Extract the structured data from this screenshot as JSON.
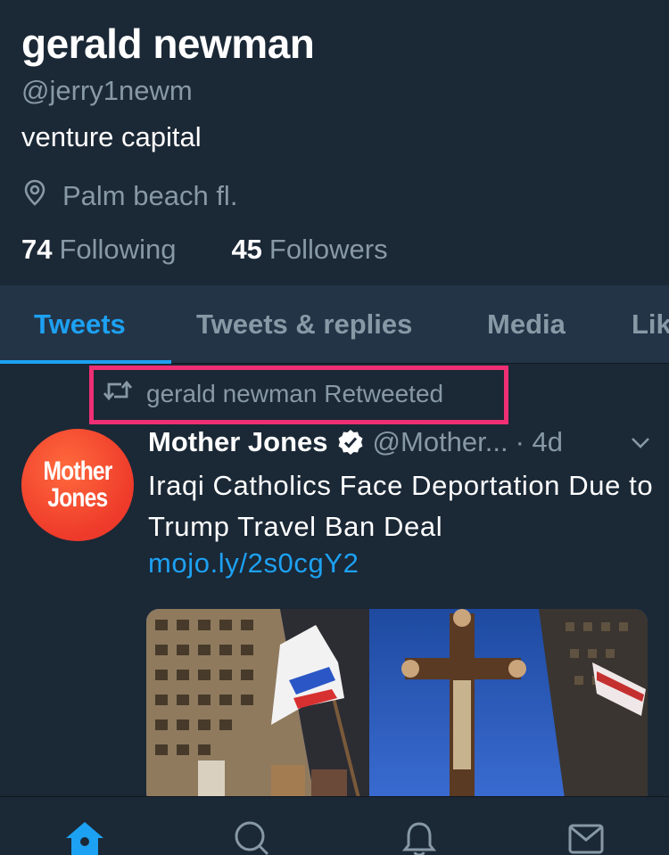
{
  "profile": {
    "display_name": "gerald newman",
    "handle": "@jerry1newm",
    "bio": "venture capital",
    "location": "Palm beach fl.",
    "following_count": "74",
    "following_label": "Following",
    "followers_count": "45",
    "followers_label": "Followers"
  },
  "tabs": [
    {
      "label": "Tweets",
      "active": true
    },
    {
      "label": "Tweets & replies",
      "active": false
    },
    {
      "label": "Media",
      "active": false
    },
    {
      "label": "Lik",
      "active": false
    }
  ],
  "tweet": {
    "retweet_label": "gerald newman Retweeted",
    "author": "Mother Jones",
    "handle": "@Mother...",
    "time": "· 4d",
    "text": "Iraqi Catholics Face Deportation Due to Trump Travel Ban Deal",
    "link": "mojo.ly/2s0cgY2",
    "avatar_text_1": "Mother",
    "avatar_text_2": "Jones"
  },
  "bottom_nav": {
    "items": [
      "home-icon",
      "search-icon",
      "notifications-icon",
      "messages-icon"
    ],
    "active": "home-icon"
  },
  "colors": {
    "background": "#1b2836",
    "tab_bar": "#243447",
    "accent": "#1da1f2",
    "muted_text": "#8899a6",
    "highlight_box": "#ef2f74",
    "avatar": "#ee3a2a"
  }
}
